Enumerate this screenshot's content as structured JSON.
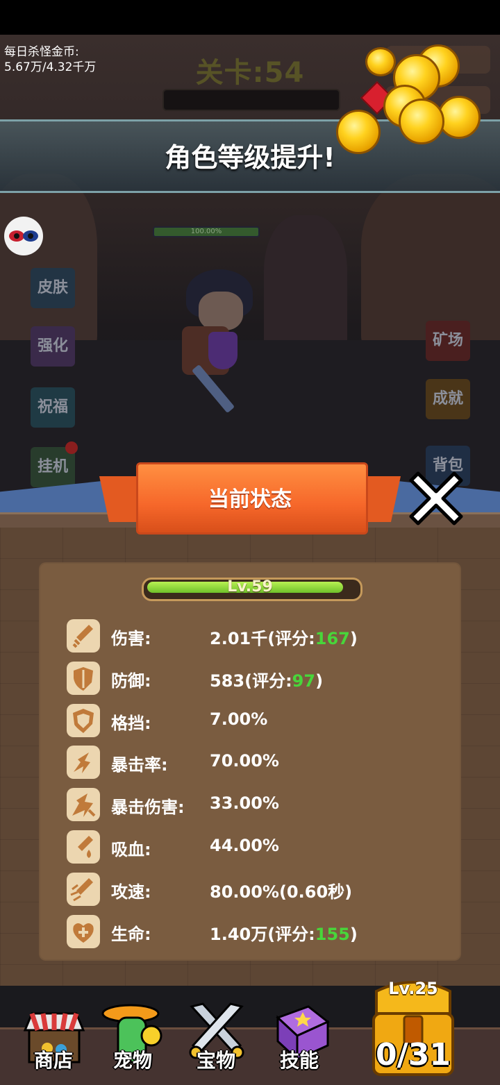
{
  "hud": {
    "daily_gold_label": "每日杀怪金币:",
    "daily_gold_value": "5.67万/4.32千万",
    "level_title": "关卡:54"
  },
  "banner": {
    "text": "角色等级提升!"
  },
  "hero": {
    "hp_percent_text": "100.00%",
    "hp_fraction": 1.0
  },
  "side_left": [
    {
      "label": "皮肤",
      "color": "#223444"
    },
    {
      "label": "强化",
      "color": "#3a2a4a"
    },
    {
      "label": "祝福",
      "color": "#1f3a44"
    },
    {
      "label": "挂机",
      "color": "#283c2c"
    }
  ],
  "side_right": [
    {
      "label": "矿场",
      "color": "#4a1f1f"
    },
    {
      "label": "成就",
      "color": "#4a3518"
    },
    {
      "label": "背包",
      "color": "#1f2e44"
    }
  ],
  "panel": {
    "title": "当前状态",
    "level_text": "Lv.59",
    "stats": [
      {
        "icon": "sword-icon",
        "label": "伤害:",
        "value": "2.01千(评分:",
        "score": "167",
        "suffix": ")"
      },
      {
        "icon": "shield-icon",
        "label": "防御:",
        "value": "583(评分:",
        "score": "97",
        "suffix": ")"
      },
      {
        "icon": "block-shield-icon",
        "label": "格挡:",
        "value": "7.00%",
        "score": "",
        "suffix": ""
      },
      {
        "icon": "crit-rate-icon",
        "label": "暴击率:",
        "value": "70.00%",
        "score": "",
        "suffix": ""
      },
      {
        "icon": "crit-damage-icon",
        "label": "暴击伤害:",
        "value": "33.00%",
        "score": "",
        "suffix": ""
      },
      {
        "icon": "lifesteal-icon",
        "label": "吸血:",
        "value": "44.00%",
        "score": "",
        "suffix": ""
      },
      {
        "icon": "attack-speed-icon",
        "label": "攻速:",
        "value": "80.00%(0.60秒)",
        "score": "",
        "suffix": ""
      },
      {
        "icon": "health-icon",
        "label": "生命:",
        "value": "1.40万(评分:",
        "score": "155",
        "suffix": ")"
      }
    ]
  },
  "bottom_nav": [
    {
      "label": "商店",
      "icon": "shop-icon"
    },
    {
      "label": "宠物",
      "icon": "pet-icon"
    },
    {
      "label": "宝物",
      "icon": "treasure-icon"
    },
    {
      "label": "技能",
      "icon": "skill-book-icon"
    }
  ],
  "chest": {
    "level": "Lv.25",
    "count": "0/31"
  },
  "colors": {
    "score_green": "#48d63a",
    "ribbon_orange": "#f6672a",
    "panel_brown": "#7a5c40"
  }
}
